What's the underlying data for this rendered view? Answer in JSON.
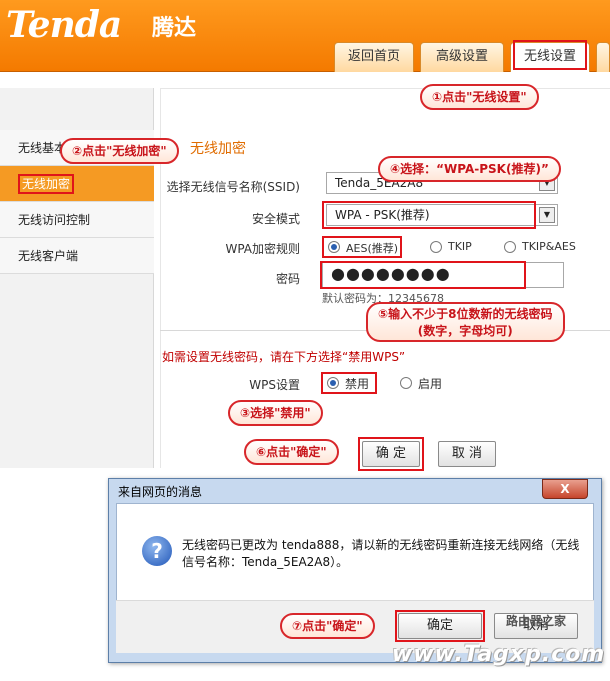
{
  "header": {
    "logo": "Tenda",
    "logo_cn": "腾达",
    "tabs": [
      {
        "label": "返回首页"
      },
      {
        "label": "高级设置"
      },
      {
        "label": "无线设置"
      }
    ]
  },
  "sidebar": {
    "items": [
      {
        "label": "无线基本设置"
      },
      {
        "label": "无线加密"
      },
      {
        "label": "无线访问控制"
      },
      {
        "label": "无线客户端"
      }
    ]
  },
  "form": {
    "section_title": "无线加密",
    "ssid_label": "选择无线信号名称(SSID)",
    "ssid_value": "Tenda_5EA2A8",
    "mode_label": "安全模式",
    "mode_value": "WPA - PSK(推荐)",
    "cipher_label": "WPA加密规则",
    "cipher_options": [
      "AES(推荐)",
      "TKIP",
      "TKIP&AES"
    ],
    "password_label": "密码",
    "password_value": "●●●●●●●●",
    "default_password": "默认密码为：12345678",
    "wps_hint": "如需设置无线密码，请在下方选择“禁用WPS”",
    "wps_label": "WPS设置",
    "wps_options": [
      "禁用",
      "启用"
    ],
    "ok_label": "确 定",
    "cancel_label": "取 消"
  },
  "callouts": {
    "step1": "①点击\"无线设置\"",
    "step2": "②点击\"无线加密\"",
    "step3": "③选择\"禁用\"",
    "step4": "④选择：“WPA-PSK(推荐)”",
    "step5_line1": "⑤输入不少于8位数新的无线密码",
    "step5_line2": "(数字，字母均可)",
    "step6": "⑥点击\"确定\"",
    "step7": "⑦点击\"确定\""
  },
  "dialog": {
    "title": "来自网页的消息",
    "close": "X",
    "message": "无线密码已更改为 tenda888，请以新的无线密码重新连接无线网络（无线信号名称：Tenda_5EA2A8）。",
    "ok_label": "确定",
    "cancel_label": "取消"
  },
  "watermark": {
    "site_cn": "路由器之家",
    "site": "www.Tagxp.com"
  },
  "colors": {
    "brand_orange": "#f47a00",
    "highlight_red": "#e0141a",
    "sidebar_active": "#f59a23"
  }
}
